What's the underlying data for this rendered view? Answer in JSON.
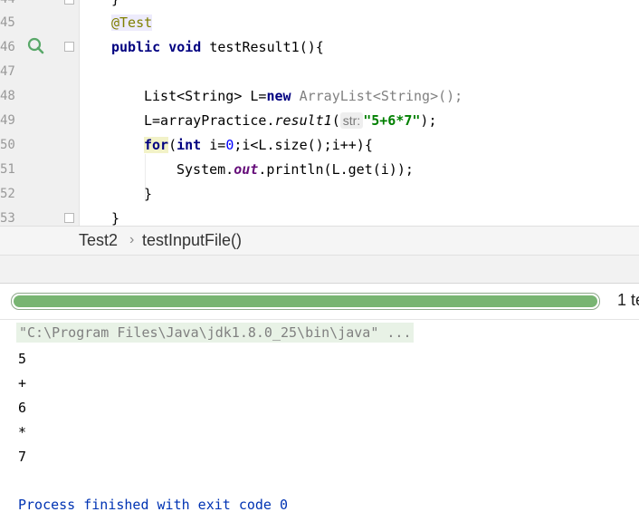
{
  "editor": {
    "line_numbers": [
      "44",
      "45",
      "46",
      "47",
      "48",
      "49",
      "50",
      "51",
      "52",
      "53"
    ],
    "lines": {
      "l44": "}",
      "l45_annotation": "@Test",
      "l46_kw1": "public",
      "l46_kw2": "void",
      "l46_rest": " testResult1(){",
      "l48_a": "List<String> L=",
      "l48_new": "new",
      "l48_b": " ArrayList<String>();",
      "l49_a": "L=arrayPractice.",
      "l49_method": "result1",
      "l49_paren": "(",
      "l49_hint": "str:",
      "l49_str": "\"5+6*7\"",
      "l49_end": ");",
      "l50_for": "for",
      "l50_paren": "(",
      "l50_int": "int",
      "l50_a": " i=",
      "l50_zero": "0",
      "l50_b": ";i<L.size();i++){",
      "l51_a": "System.",
      "l51_out": "out",
      "l51_b": ".println(L.get(i));",
      "l52": "}",
      "l53": "}"
    }
  },
  "breadcrumb": {
    "class_name": "Test2",
    "separator": "›",
    "method_name": "testInputFile()"
  },
  "runner": {
    "progress": 1.0,
    "bar_color": "#78b572",
    "test_count": "1 te"
  },
  "console": {
    "command": "\"C:\\Program Files\\Java\\jdk1.8.0_25\\bin\\java\" ...",
    "output": [
      "5",
      "+",
      "6",
      "*",
      "7"
    ],
    "finish_message": "Process finished with exit code 0"
  }
}
